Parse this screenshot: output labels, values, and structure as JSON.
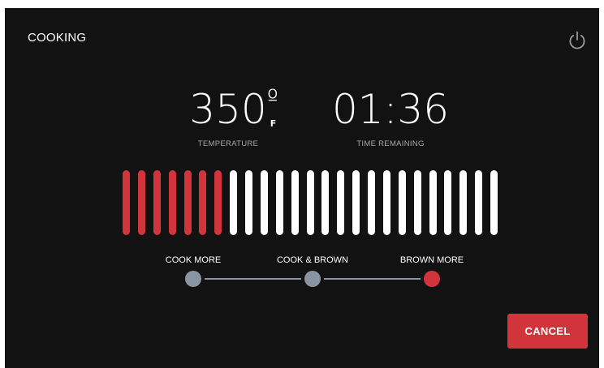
{
  "header": {
    "title": "COOKING",
    "power_icon": "power-icon"
  },
  "temperature": {
    "value": "350",
    "degree_symbol": "º",
    "unit": "F",
    "label": "TEMPERATURE"
  },
  "time": {
    "value": "01:36",
    "label": "TIME REMAINING"
  },
  "progress": {
    "total_segments": 25,
    "filled_segments": 7,
    "filled_color": "#d1343a",
    "empty_color": "#ffffff"
  },
  "browning": {
    "options": [
      "COOK MORE",
      "COOK & BROWN",
      "BROWN MORE"
    ],
    "selected_index": 2,
    "active_color": "#d1343a",
    "inactive_color": "#8a95a3"
  },
  "actions": {
    "cancel_label": "CANCEL",
    "cancel_color": "#d1343a"
  }
}
